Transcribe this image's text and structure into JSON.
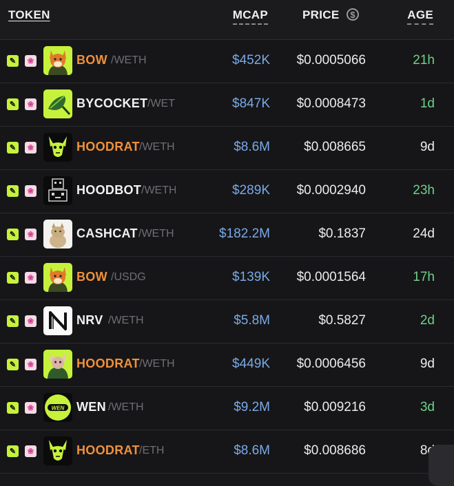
{
  "header": {
    "token": "TOKEN",
    "mcap": "MCAP",
    "price": "PRICE",
    "price_icon": "$",
    "age": "AGE"
  },
  "colors": {
    "orange": "#f0913a",
    "white": "#f2f2f2",
    "mcap_blue": "#7aa9e6",
    "age_green": "#6fd08a",
    "age_white": "#ececec",
    "lime": "#c6f23c"
  },
  "rows": [
    {
      "symbol": "BOW",
      "pair": "/WETH",
      "mcap": "$452K",
      "price": "$0.0005066",
      "age": "21h",
      "symbol_color": "#f0913a",
      "age_color": "#6fd08a",
      "avatar": "fox-hoodie-icon"
    },
    {
      "symbol": "BYCOCKET",
      "pair": "/WET",
      "mcap": "$847K",
      "price": "$0.0008473",
      "age": "1d",
      "symbol_color": "#f2f2f2",
      "age_color": "#6fd08a",
      "avatar": "green-feather-cap-icon"
    },
    {
      "symbol": "HOODRAT",
      "pair": "/WETH",
      "mcap": "$8.6M",
      "price": "$0.008665",
      "age": "9d",
      "symbol_color": "#f0913a",
      "age_color": "#ececec",
      "avatar": "rat-skull-icon"
    },
    {
      "symbol": "HOODBOT",
      "pair": "/WETH",
      "mcap": "$289K",
      "price": "$0.0002940",
      "age": "23h",
      "symbol_color": "#f2f2f2",
      "age_color": "#6fd08a",
      "avatar": "pixel-robot-icon"
    },
    {
      "symbol": "CASHCAT",
      "pair": "/WETH",
      "mcap": "$182.2M",
      "price": "$0.1837",
      "age": "24d",
      "symbol_color": "#f2f2f2",
      "age_color": "#ececec",
      "avatar": "cat-photo-icon"
    },
    {
      "symbol": "BOW",
      "pair": "/USDG",
      "mcap": "$139K",
      "price": "$0.0001564",
      "age": "17h",
      "symbol_color": "#f0913a",
      "age_color": "#6fd08a",
      "avatar": "fox-hoodie-icon"
    },
    {
      "symbol": "NRV",
      "pair": "/WETH",
      "mcap": "$5.8M",
      "price": "$0.5827",
      "age": "2d",
      "symbol_color": "#f2f2f2",
      "age_color": "#6fd08a",
      "avatar": "nrv-logo-icon"
    },
    {
      "symbol": "HOODRAT",
      "pair": "/WETH",
      "mcap": "$449K",
      "price": "$0.0006456",
      "age": "9d",
      "symbol_color": "#f0913a",
      "age_color": "#ececec",
      "avatar": "rat-hoodie-icon"
    },
    {
      "symbol": "WEN",
      "pair": "/WETH",
      "mcap": "$9.2M",
      "price": "$0.009216",
      "age": "3d",
      "symbol_color": "#f2f2f2",
      "age_color": "#6fd08a",
      "avatar": "wen-coin-icon",
      "avatar_text": "WEN"
    },
    {
      "symbol": "HOODRAT",
      "pair": "/ETH",
      "mcap": "$8.6M",
      "price": "$0.008686",
      "age": "8d",
      "symbol_color": "#f0913a",
      "age_color": "#ececec",
      "avatar": "rat-skull-icon"
    }
  ]
}
